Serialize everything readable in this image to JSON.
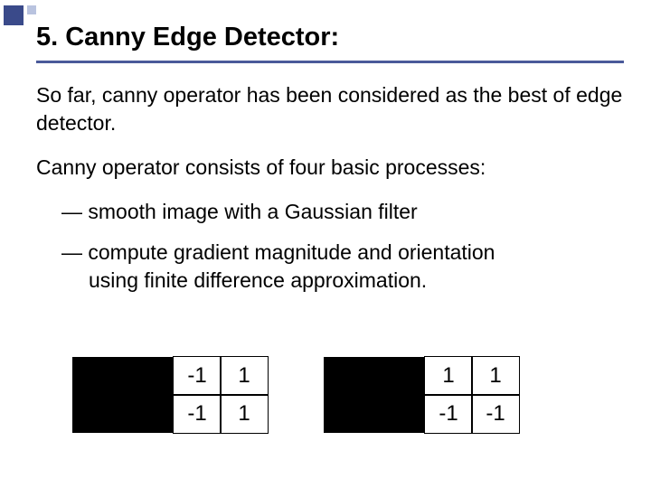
{
  "title": "5. Canny Edge Detector:",
  "para1": "So far, canny operator has been considered as the best of edge detector.",
  "para2": "Canny operator consists of four basic processes:",
  "bullets": {
    "b1": "— smooth image with a Gaussian filter",
    "b2": "— compute gradient magnitude and orientation",
    "b2cont": "using finite difference approximation."
  },
  "kernel1": {
    "r0c0": "-1",
    "r0c1": "1",
    "r1c0": "-1",
    "r1c1": "1"
  },
  "kernel2": {
    "r0c0": "1",
    "r0c1": "1",
    "r1c0": "-1",
    "r1c1": "-1"
  },
  "chart_data": [
    {
      "type": "table",
      "title": "Horizontal difference kernel",
      "rows": [
        [
          -1,
          1
        ],
        [
          -1,
          1
        ]
      ]
    },
    {
      "type": "table",
      "title": "Vertical difference kernel",
      "rows": [
        [
          1,
          1
        ],
        [
          -1,
          -1
        ]
      ]
    }
  ]
}
